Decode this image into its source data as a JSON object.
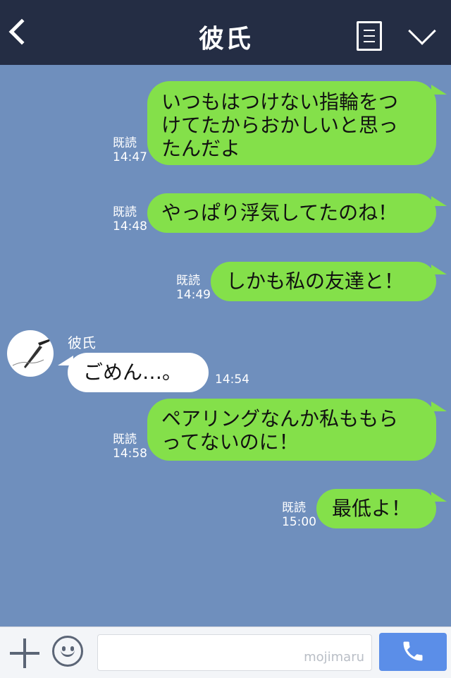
{
  "header": {
    "title": "彼氏"
  },
  "contact": {
    "name": "彼氏"
  },
  "messages": [
    {
      "direction": "out",
      "lines": [
        "いつもはつけない指輪をつ",
        "けてたからおかしいと思っ",
        "たんだよ"
      ],
      "read": "既読",
      "time": "14:47"
    },
    {
      "direction": "out",
      "lines": [
        "やっぱり浮気してたのね！"
      ],
      "read": "既読",
      "time": "14:48"
    },
    {
      "direction": "out",
      "lines": [
        "しかも私の友達と！"
      ],
      "read": "既読",
      "time": "14:49"
    },
    {
      "direction": "in",
      "lines": [
        "ごめん…。"
      ],
      "time": "14:54"
    },
    {
      "direction": "out",
      "lines": [
        "ペアリングなんか私ももら",
        "ってないのに！"
      ],
      "read": "既読",
      "time": "14:58"
    },
    {
      "direction": "out",
      "lines": [
        "最低よ！"
      ],
      "read": "既読",
      "time": "15:00"
    }
  ],
  "footer": {
    "watermark": "mojimaru"
  },
  "icons": [
    "back-icon",
    "menu-icon",
    "chevron-down-icon",
    "plus-icon",
    "smile-icon",
    "phone-icon"
  ],
  "colors": {
    "header": "#242d44",
    "background": "#6f8fbd",
    "outgoing_bubble": "#84e04a",
    "incoming_bubble": "#ffffff",
    "call_button": "#5b8ee8"
  }
}
